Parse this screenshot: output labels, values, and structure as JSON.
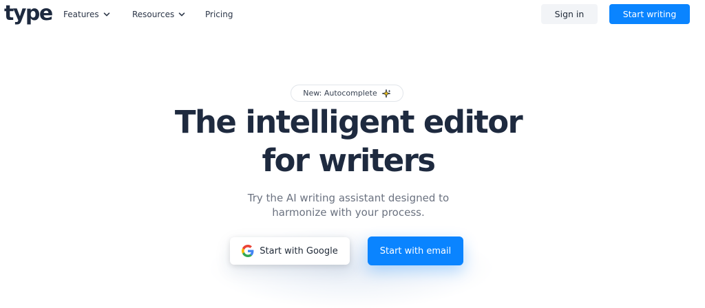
{
  "brand": {
    "logo_text": "type"
  },
  "nav": {
    "features_label": "Features",
    "resources_label": "Resources",
    "pricing_label": "Pricing"
  },
  "header_actions": {
    "signin_label": "Sign in",
    "start_writing_label": "Start writing"
  },
  "hero": {
    "badge_text": "New: Autocomplete",
    "badge_icon": "sparkle-icon",
    "title_line1": "The intelligent editor",
    "title_line2": "for writers",
    "subtitle_line1": "Try the AI writing assistant designed to",
    "subtitle_line2": "harmonize with your process.",
    "google_button_label": "Start with Google",
    "email_button_label": "Start with email"
  },
  "colors": {
    "accent": "#0a84ff",
    "heading": "#1e2a3f",
    "muted": "#6b7280",
    "signin_bg": "#f2f4f7"
  }
}
